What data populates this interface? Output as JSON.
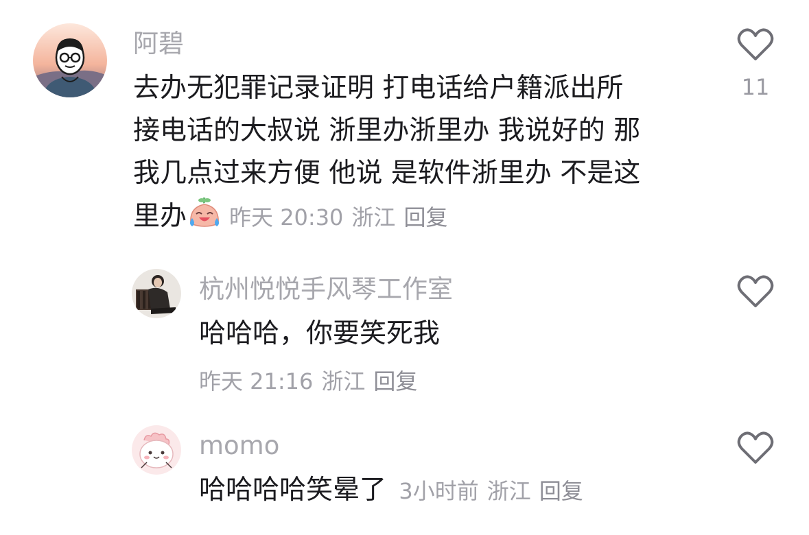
{
  "comments": [
    {
      "username": "阿碧",
      "lines": [
        "去办无犯罪记录证明 打电话给户籍派出所",
        "接电话的大叔说 浙里办浙里办 我说好的 那",
        "我几点过来方便 他说 是软件浙里办 不是这",
        "里办"
      ],
      "emoji": "crying-laughing-emoji",
      "time": "昨天 20:30",
      "location": "浙江",
      "reply_label": "回复",
      "likes": "11"
    },
    {
      "username": "杭州悦悦手风琴工作室",
      "text": "哈哈哈，你要笑死我",
      "time": "昨天 21:16",
      "location": "浙江",
      "reply_label": "回复"
    },
    {
      "username": "momo",
      "text": "哈哈哈哈笑晕了",
      "time": "3小时前",
      "location": "浙江",
      "reply_label": "回复"
    }
  ],
  "colors": {
    "text": "#1b1b1f",
    "username": "#a7a7ad",
    "meta": "#a1a1a8",
    "heart": "#6e6e75"
  }
}
